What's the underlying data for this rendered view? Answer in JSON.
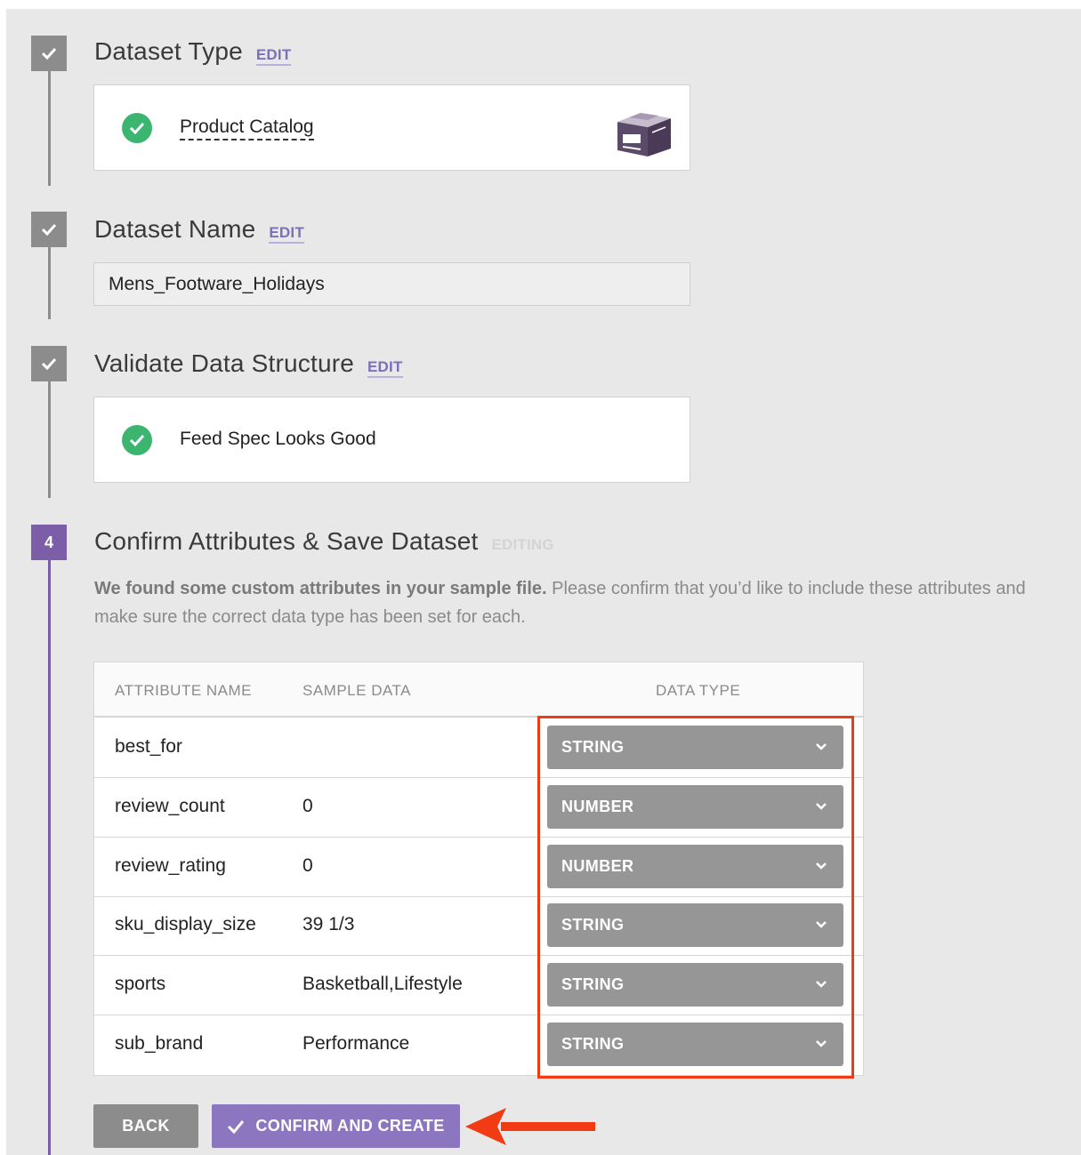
{
  "steps": [
    {
      "marker": "",
      "title": "Dataset Type",
      "status_label": "EDIT"
    },
    {
      "marker": "",
      "title": "Dataset Name",
      "status_label": "EDIT"
    },
    {
      "marker": "",
      "title": "Validate Data Structure",
      "status_label": "EDIT"
    },
    {
      "marker": "4",
      "title": "Confirm Attributes & Save Dataset",
      "status_label": "EDITING"
    }
  ],
  "dataset_type": {
    "value": "Product Catalog",
    "icon": "box-icon"
  },
  "dataset_name": {
    "value": "Mens_Footware_Holidays"
  },
  "validation": {
    "message": "Feed Spec Looks Good"
  },
  "description": {
    "bold": "We found some custom attributes in your sample file.",
    "rest": " Please confirm that you’d like to include these attributes and make sure the correct data type has been set for each."
  },
  "table": {
    "headers": {
      "name": "ATTRIBUTE NAME",
      "sample": "SAMPLE DATA",
      "type": "DATA TYPE"
    },
    "rows": [
      {
        "name": "best_for",
        "sample": "",
        "type": "STRING"
      },
      {
        "name": "review_count",
        "sample": "0",
        "type": "NUMBER"
      },
      {
        "name": "review_rating",
        "sample": "0",
        "type": "NUMBER"
      },
      {
        "name": "sku_display_size",
        "sample": "39 1/3",
        "type": "STRING"
      },
      {
        "name": "sports",
        "sample": "Basketball,Lifestyle",
        "type": "STRING"
      },
      {
        "name": "sub_brand",
        "sample": "Performance",
        "type": "STRING"
      }
    ]
  },
  "buttons": {
    "back": "BACK",
    "confirm": "CONFIRM AND CREATE"
  },
  "colors": {
    "accent": "#7b5ea7",
    "success": "#3bb56f",
    "highlight": "#f03b13",
    "select_bg": "#969696"
  }
}
